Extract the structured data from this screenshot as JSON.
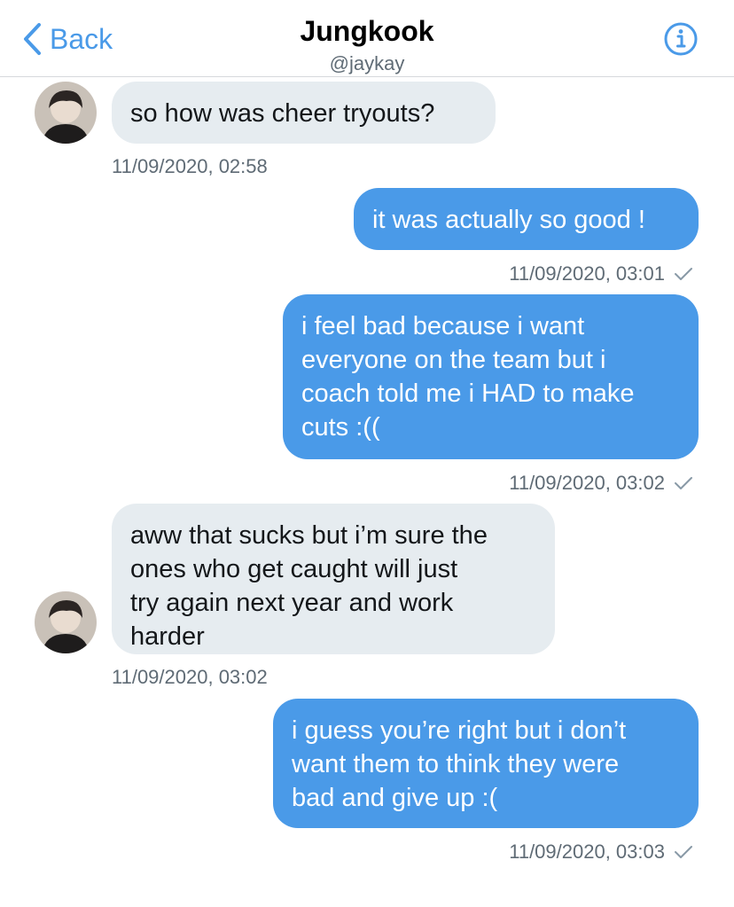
{
  "header": {
    "back_label": "Back",
    "title": "Jungkook",
    "handle": "@jaykay"
  },
  "colors": {
    "accent": "#4a9ae8",
    "incoming_bubble": "#e6ecf0",
    "outgoing_bubble": "#4a9ae8"
  },
  "messages": [
    {
      "side": "incoming",
      "text": "so how was cheer tryouts?",
      "timestamp": "11/09/2020, 02:58"
    },
    {
      "side": "outgoing",
      "text": "it was actually so good !",
      "timestamp": "11/09/2020, 03:01",
      "status": "sent"
    },
    {
      "side": "outgoing",
      "text": "i feel bad because i want\neveryone on the team but i\ncoach told me i HAD to make\ncuts :((",
      "timestamp": "11/09/2020, 03:02",
      "status": "sent"
    },
    {
      "side": "incoming",
      "text": "aww that sucks but i’m sure the\nones who get caught will just\ntry again next year and work\nharder",
      "timestamp": "11/09/2020, 03:02"
    },
    {
      "side": "outgoing",
      "text": "i guess you’re right but i don’t\nwant them to think they were\nbad and give up :(",
      "timestamp": "11/09/2020, 03:03",
      "status": "sent"
    }
  ]
}
